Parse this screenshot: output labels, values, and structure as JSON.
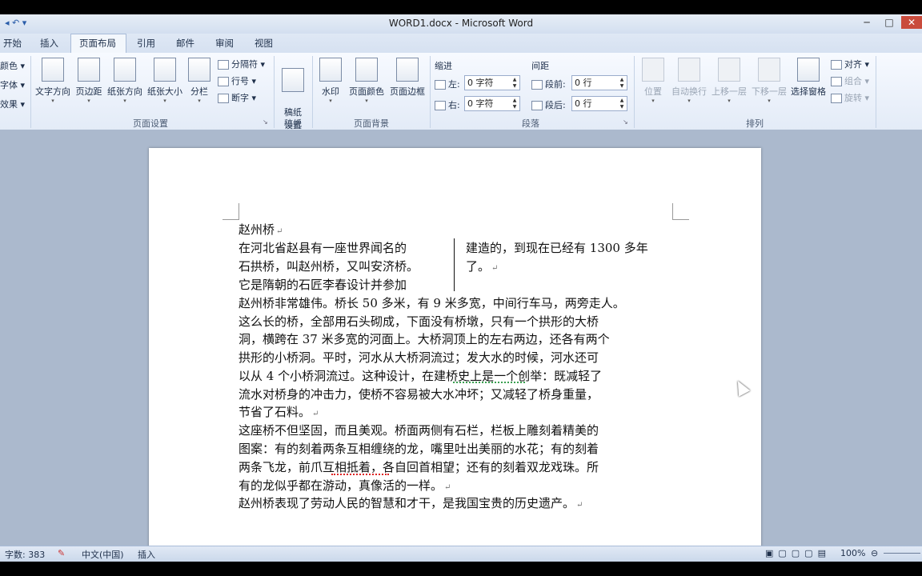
{
  "window": {
    "title": "WORD1.docx - Microsoft Word",
    "min_label": "─",
    "max_label": "□",
    "close_label": "✕"
  },
  "tabs": [
    "开始",
    "插入",
    "页面布局",
    "引用",
    "邮件",
    "审阅",
    "视图"
  ],
  "active_tab": "页面布局",
  "ribbon": {
    "theme_items": [
      "颜色",
      "字体",
      "效果"
    ],
    "page_setup": {
      "buttons": [
        "文字方向",
        "页边距",
        "纸张方向",
        "纸张大小",
        "分栏"
      ],
      "small_items": [
        "分隔符",
        "行号",
        "断字"
      ],
      "group_label": "页面设置"
    },
    "manuscript": {
      "button": "稿纸\n设置",
      "group_label": "稿纸"
    },
    "page_background": {
      "buttons": [
        "水印",
        "页面颜色",
        "页面边框"
      ],
      "group_label": "页面背景"
    },
    "paragraph": {
      "indent_label": "缩进",
      "spacing_label": "间距",
      "left_label": "左:",
      "right_label": "右:",
      "before_label": "段前:",
      "after_label": "段后:",
      "left_value": "0 字符",
      "right_value": "0 字符",
      "before_value": "0 行",
      "after_value": "0 行",
      "group_label": "段落"
    },
    "arrange": {
      "buttons": [
        "位置",
        "自动换行",
        "上移一层",
        "下移一层",
        "选择窗格"
      ],
      "small_items": [
        "对齐",
        "组合",
        "旋转"
      ],
      "group_label": "排列"
    }
  },
  "document": {
    "title_line": "赵州桥",
    "col1": [
      "在河北省赵县有一座世界闻名的",
      "石拱桥，叫赵州桥，又叫安济桥。",
      "它是隋朝的石匠李春设计并参加"
    ],
    "col2": [
      "建造的，到现在已经有 1300 多年",
      "了。"
    ],
    "p2": [
      "赵州桥非常雄伟。桥长 50 多米，有 9 米多宽，中间行车马，两旁走人。",
      "这么长的桥，全部用石头砌成，下面没有桥墩，只有一个拱形的大桥",
      "洞，横跨在 37 米多宽的河面上。大桥洞顶上的左右两边，还各有两个",
      "拱形的小桥洞。平时，河水从大桥洞流过；发大水的时候，河水还可",
      "以从 4 个小桥洞流过。这种设计，在建桥史上是一个创举：既减轻了",
      "流水对桥身的冲击力，使桥不容易被大水冲坏；又减轻了桥身重量，",
      "节省了石料。"
    ],
    "p3": [
      "这座桥不但坚固，而且美观。桥面两侧有石栏，栏板上雕刻着精美的",
      "图案：有的刻着两条互相缠绕的龙，嘴里吐出美丽的水花；有的刻着",
      "两条飞龙，前爪互相抵着，各自回首相望；还有的刻着双龙戏珠。所",
      "有的龙似乎都在游动，真像活的一样。"
    ],
    "p4": "赵州桥表现了劳动人民的智慧和才干，是我国宝贵的历史遗产。",
    "para_mark": "↵"
  },
  "status": {
    "word_count": "字数: 383",
    "language": "中文(中国)",
    "mode": "插入",
    "zoom": "100%"
  }
}
